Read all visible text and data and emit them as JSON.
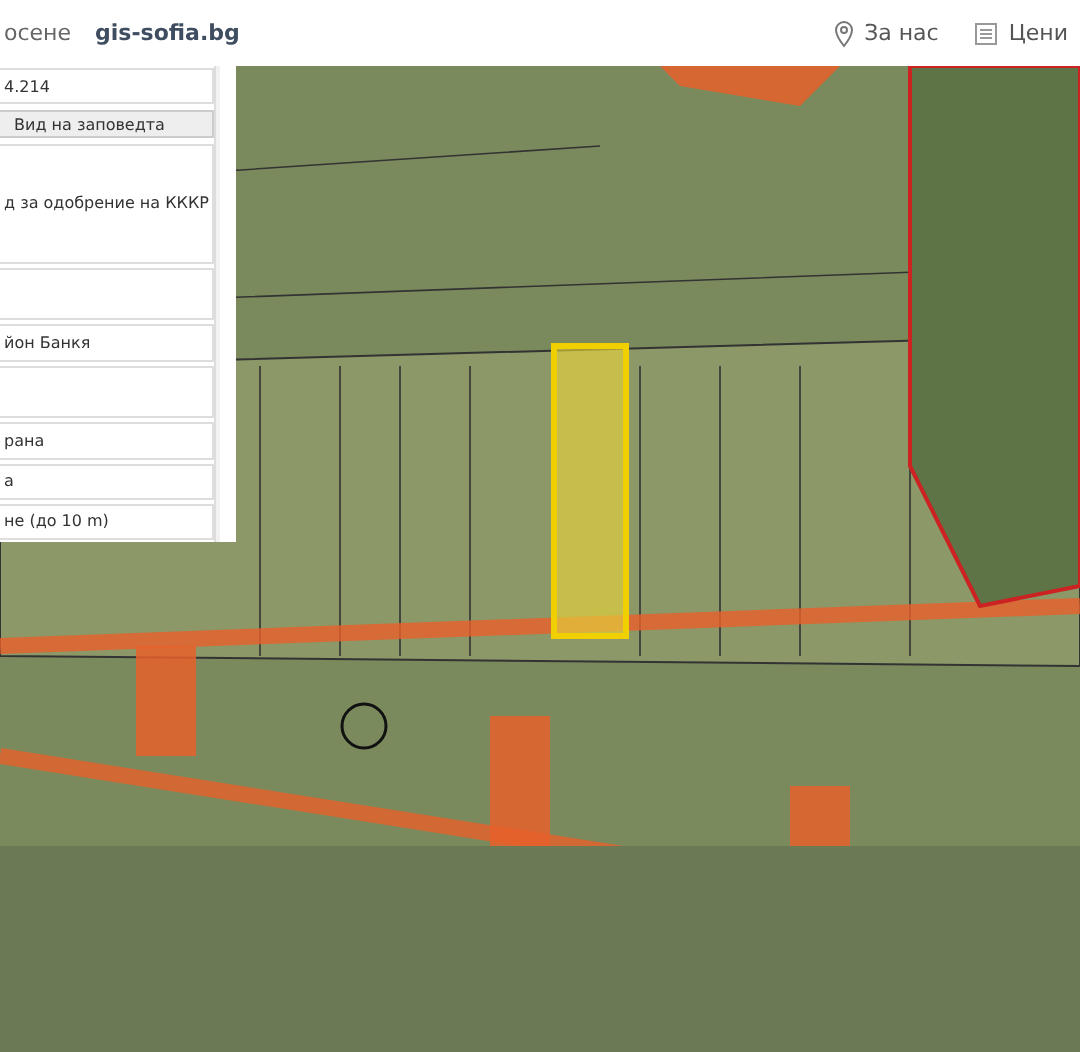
{
  "header": {
    "left_text": "осене",
    "site": "gis-sofia.bg",
    "links": [
      {
        "kind": "pin",
        "label": "За нас"
      },
      {
        "kind": "doc",
        "label": "Цени"
      }
    ]
  },
  "panel": {
    "rows": [
      {
        "kind": "field",
        "text": "4.214"
      },
      {
        "kind": "button",
        "text": "Вид на заповедта"
      },
      {
        "kind": "tall",
        "text": "д за одобрение на КККР"
      },
      {
        "kind": "blank"
      },
      {
        "kind": "field",
        "text": "йон Банкя"
      },
      {
        "kind": "blank"
      },
      {
        "kind": "field",
        "text": "рана"
      },
      {
        "kind": "field",
        "text": "а"
      },
      {
        "kind": "field",
        "text": "не (до 10 m)"
      }
    ]
  }
}
